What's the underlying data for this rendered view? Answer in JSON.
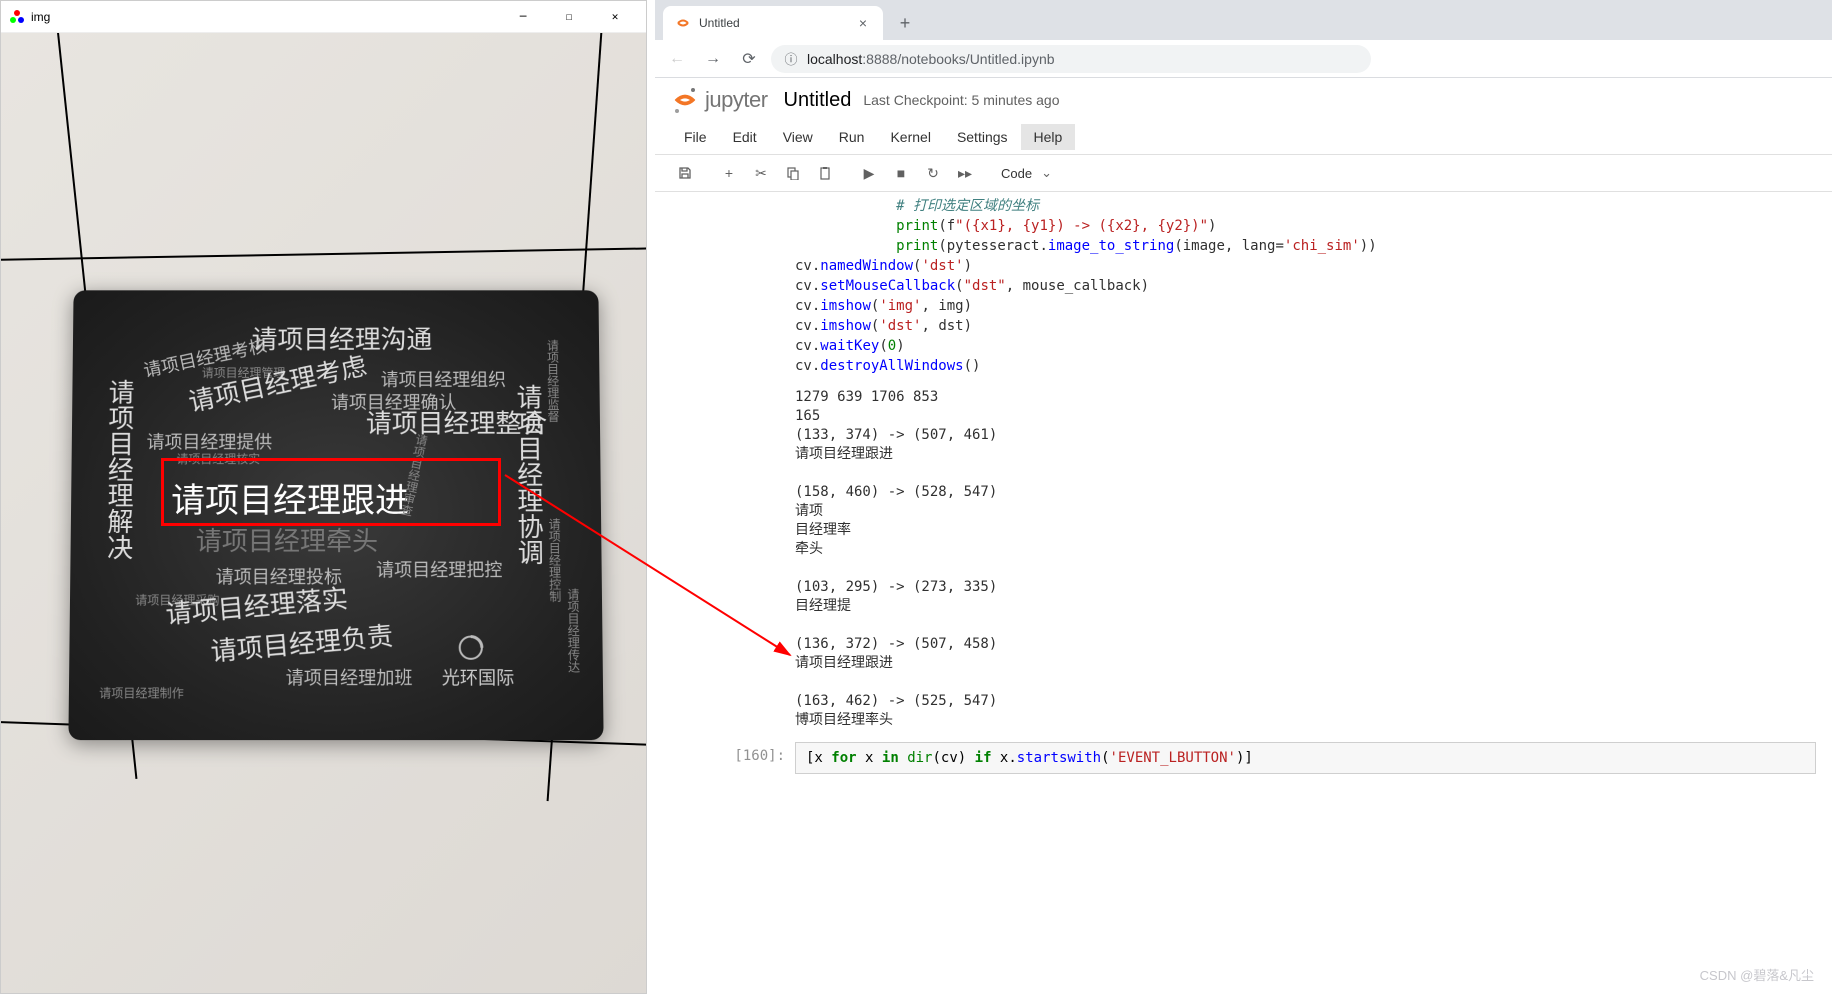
{
  "cv_window": {
    "title": "img",
    "pad_texts": {
      "t1": "请项目经理沟通",
      "t2": "请项目经理考虑",
      "t3": "请项目经理整合",
      "t4": "请项目经理确认",
      "t5": "请项目经理提供",
      "t6": "请项目经理核实",
      "t7": "请项目经理跟进",
      "t8": "请项目经理牵头",
      "t9": "请项目经理投标",
      "t10": "请项目经理把控",
      "t11": "请项目经理落实",
      "t12": "请项目经理负责",
      "t13": "请项目经理加班",
      "t14": "请项目经理制作",
      "t15": "请项目经理采购",
      "v1": "请项目经理解决",
      "v2": "请项目经理协调",
      "v3": "请项目经理组织",
      "v4": "请项目经理管理",
      "v5": "请项目经理考核",
      "v6": "请项目经理审查",
      "v7": "请项目经理控制",
      "v8": "请项目经理监督",
      "v9": "请项目经理传达",
      "brand": "光环国际"
    }
  },
  "browser": {
    "tab_title": "Untitled",
    "url_host": "localhost",
    "url_port": ":8888",
    "url_path": "/notebooks/Untitled.ipynb"
  },
  "jupyter": {
    "brand": "jupyter",
    "nb_name": "Untitled",
    "checkpoint": "Last Checkpoint: 5 minutes ago",
    "menus": [
      "File",
      "Edit",
      "View",
      "Run",
      "Kernel",
      "Settings",
      "Help"
    ],
    "cell_type": "Code"
  },
  "code": {
    "comment": "# 打印选定区域的坐标",
    "l1a": "print",
    "l1b": "(f",
    "l1c": "\"({x1}, {y1}) -> ({x2}, {y2})\"",
    "l1d": ")",
    "l2a": "print",
    "l2b": "(pytesseract.",
    "l2c": "image_to_string",
    "l2d": "(image, lang=",
    "l2e": "'chi_sim'",
    "l2f": "))",
    "l3a": "cv.",
    "l3b": "namedWindow",
    "l3c": "(",
    "l3d": "'dst'",
    "l3e": ")",
    "l4a": "cv.",
    "l4b": "setMouseCallback",
    "l4c": "(",
    "l4d": "\"dst\"",
    "l4e": ", mouse_callback)",
    "l5a": "cv.",
    "l5b": "imshow",
    "l5c": "(",
    "l5d": "'img'",
    "l5e": ", img)",
    "l6a": "cv.",
    "l6b": "imshow",
    "l6c": "(",
    "l6d": "'dst'",
    "l6e": ", dst)",
    "l7a": "cv.",
    "l7b": "waitKey",
    "l7c": "(",
    "l7d": "0",
    "l7e": ")",
    "l8a": "cv.",
    "l8b": "destroyAllWindows",
    "l8c": "()"
  },
  "output": "1279 639 1706 853\n165\n(133, 374) -> (507, 461)\n请项目经理跟进\n\n(158, 460) -> (528, 547)\n请项\n目经理率\n牵头\n\n(103, 295) -> (273, 335)\n目经理提\n\n(136, 372) -> (507, 458)\n请项目经理跟进\n\n(163, 462) -> (525, 547)\n博项目经理率头",
  "cell160": {
    "prompt": "[160]:",
    "a": "[x ",
    "b": "for",
    "c": " x ",
    "d": "in",
    "e": " ",
    "f": "dir",
    "g": "(cv) ",
    "h": "if",
    "i": " x.",
    "j": "startswith",
    "k": "(",
    "l": "'EVENT_LBUTTON'",
    "m": ")]"
  },
  "watermark": "CSDN @碧落&凡尘"
}
